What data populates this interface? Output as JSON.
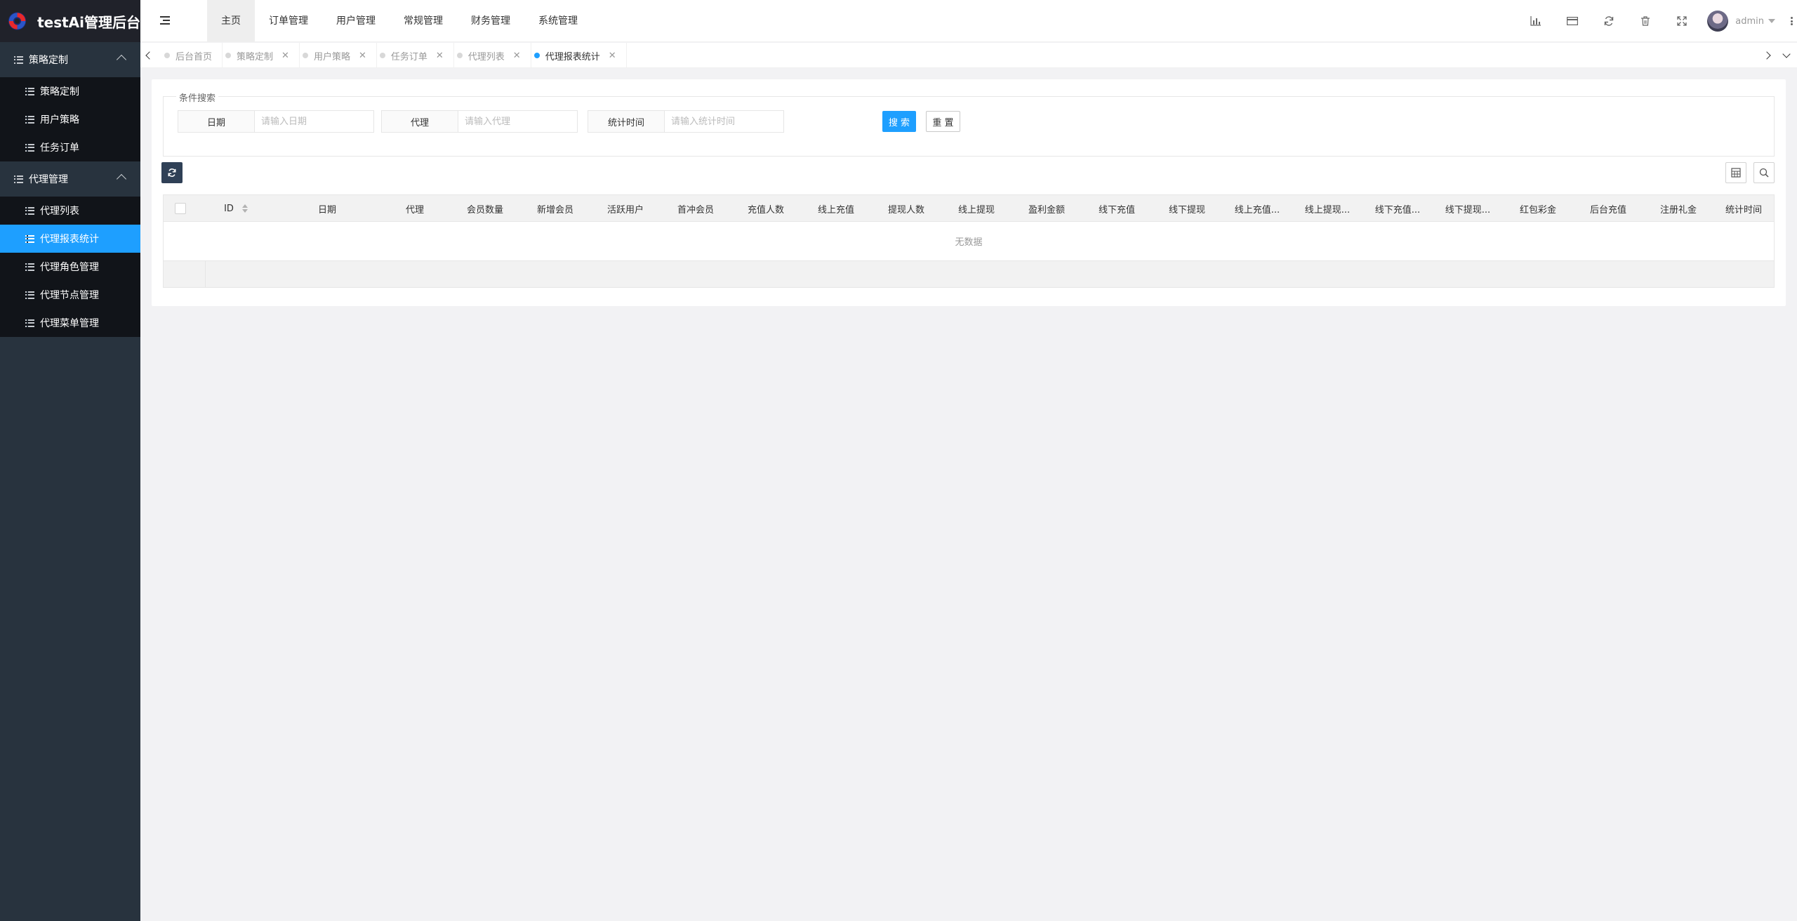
{
  "app": {
    "title": "testAi管理后台"
  },
  "sidebar": {
    "groups": [
      {
        "label": "策略定制",
        "items": [
          {
            "label": "策略定制"
          },
          {
            "label": "用户策略"
          },
          {
            "label": "任务订单"
          }
        ]
      },
      {
        "label": "代理管理",
        "items": [
          {
            "label": "代理列表"
          },
          {
            "label": "代理报表统计"
          },
          {
            "label": "代理角色管理"
          },
          {
            "label": "代理节点管理"
          },
          {
            "label": "代理菜单管理"
          }
        ]
      }
    ],
    "active_item": "代理报表统计"
  },
  "header": {
    "nav": [
      {
        "label": "主页"
      },
      {
        "label": "订单管理"
      },
      {
        "label": "用户管理"
      },
      {
        "label": "常规管理"
      },
      {
        "label": "财务管理"
      },
      {
        "label": "系统管理"
      }
    ],
    "active_nav": "主页",
    "user_name": "admin",
    "icons": [
      "bar-chart-icon",
      "card-icon",
      "refresh-icon",
      "trash-icon",
      "fullscreen-icon"
    ]
  },
  "tabs": [
    {
      "label": "后台首页",
      "closable": false
    },
    {
      "label": "策略定制",
      "closable": true
    },
    {
      "label": "用户策略",
      "closable": true
    },
    {
      "label": "任务订单",
      "closable": true
    },
    {
      "label": "代理列表",
      "closable": true
    },
    {
      "label": "代理报表统计",
      "closable": true,
      "active": true
    }
  ],
  "search": {
    "legend": "条件搜索",
    "fields": [
      {
        "label": "日期",
        "placeholder": "请输入日期"
      },
      {
        "label": "代理",
        "placeholder": "请输入代理"
      },
      {
        "label": "统计时间",
        "placeholder": "请输入统计时间"
      }
    ],
    "search_label": "搜 索",
    "reset_label": "重 置"
  },
  "table": {
    "columns": [
      "ID",
      "日期",
      "代理",
      "会员数量",
      "新增会员",
      "活跃用户",
      "首冲会员",
      "充值人数",
      "线上充值",
      "提现人数",
      "线上提现",
      "盈利金额",
      "线下充值",
      "线下提现",
      "线上充值...",
      "线上提现...",
      "线下充值...",
      "线下提现...",
      "红包彩金",
      "后台充值",
      "注册礼金",
      "统计时间"
    ],
    "empty_text": "无数据"
  },
  "colors": {
    "accent": "#1e9fff",
    "sidebar_bg": "#28333e",
    "logo_bg": "#20222a"
  }
}
